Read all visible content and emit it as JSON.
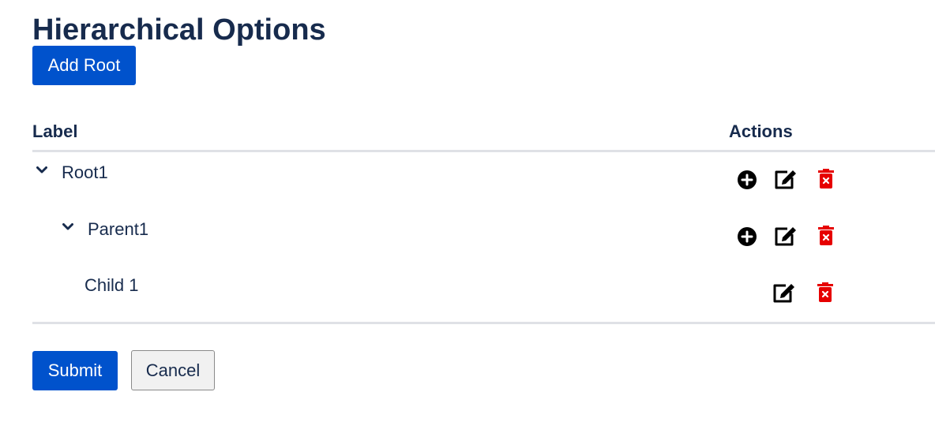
{
  "page": {
    "title": "Hierarchical Options"
  },
  "toolbar": {
    "add_root_label": "Add Root"
  },
  "table": {
    "columns": {
      "label": "Label",
      "actions": "Actions"
    },
    "rows": [
      {
        "label": "Root1",
        "level": 0,
        "expanded": true,
        "actions": [
          "add-icon",
          "edit-icon",
          "delete-icon"
        ]
      },
      {
        "label": "Parent1",
        "level": 1,
        "expanded": true,
        "actions": [
          "add-icon",
          "edit-icon",
          "delete-icon"
        ]
      },
      {
        "label": "Child 1",
        "level": 2,
        "expanded": false,
        "actions": [
          "edit-icon",
          "delete-icon"
        ]
      }
    ]
  },
  "footer": {
    "submit_label": "Submit",
    "cancel_label": "Cancel"
  },
  "colors": {
    "primary": "#0052cc",
    "text": "#172b4d",
    "danger": "#e60000",
    "icon": "#000000"
  }
}
